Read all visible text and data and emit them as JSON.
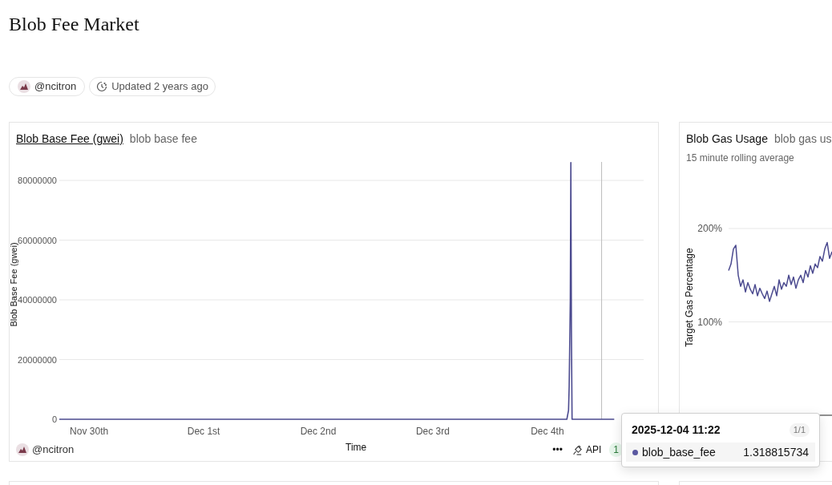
{
  "page": {
    "title": "Blob Fee Market"
  },
  "meta": {
    "author": "@ncitron",
    "updated": "Updated 2 years ago"
  },
  "fee_card": {
    "title": "Blob Base Fee (gwei)",
    "subtitle": "blob base fee",
    "chart_data": {
      "type": "line",
      "xlabel": "Time",
      "ylabel": "Blob Base Fee (gwei)",
      "x": [
        "2025-11-29T17:46",
        "2025-12-04T04:05",
        "2025-12-04T04:26",
        "2025-12-04T04:34",
        "2025-12-04T04:48",
        "2025-12-04T04:55",
        "2025-12-04T05:02",
        "2025-12-04T05:10",
        "2025-12-04T05:17",
        "2025-12-04T14:00"
      ],
      "series": [
        {
          "color": "#4b4a8f",
          "values": [
            0,
            0,
            3000000,
            11000000,
            40000000,
            86000000,
            30000000,
            0,
            0,
            0
          ]
        }
      ],
      "xlim": [
        "2025-11-29T17:46",
        "2025-12-04T20:10"
      ],
      "ylim": [
        0,
        86200000
      ],
      "grid": true,
      "ref_lines": [
        {
          "axis": "x",
          "value": "2025-12-04T11:22"
        }
      ],
      "xticks": [
        {
          "value": "2025-11-30T00:00",
          "label": "Nov 30th"
        },
        {
          "value": "2025-12-01T00:00",
          "label": "Dec 1st"
        },
        {
          "value": "2025-12-02T00:00",
          "label": "Dec 2nd"
        },
        {
          "value": "2025-12-03T00:00",
          "label": "Dec 3rd"
        },
        {
          "value": "2025-12-04T00:00",
          "label": "Dec 4th"
        }
      ],
      "yticks": [
        {
          "value": 0,
          "label": "0"
        },
        {
          "value": 20000000,
          "label": "20000000"
        },
        {
          "value": 40000000,
          "label": "40000000"
        },
        {
          "value": 60000000,
          "label": "60000000"
        },
        {
          "value": 80000000,
          "label": "80000000"
        }
      ]
    },
    "author": "@ncitron",
    "more": "•••",
    "api": "API",
    "badge": "1"
  },
  "gas_card": {
    "title": "Blob Gas Usage",
    "subtitle": "blob gas us",
    "note": "15 minute rolling average",
    "chart_data": {
      "type": "line",
      "ylabel": "Target Gas Percentage",
      "ylim": [
        0,
        2
      ],
      "yticks": [
        {
          "value": 1,
          "label": "100%"
        },
        {
          "value": 2,
          "label": "200%"
        }
      ],
      "series": [
        {
          "color": "#4b4a8f",
          "values": [
            1.55,
            1.62,
            1.78,
            1.82,
            1.5,
            1.38,
            1.45,
            1.32,
            1.42,
            1.35,
            1.3,
            1.4,
            1.28,
            1.36,
            1.3,
            1.25,
            1.33,
            1.22,
            1.3,
            1.38,
            1.28,
            1.45,
            1.35,
            1.42,
            1.38,
            1.5,
            1.4,
            1.48,
            1.36,
            1.45,
            1.5,
            1.42,
            1.55,
            1.48,
            1.6,
            1.52,
            1.62,
            1.58,
            1.7,
            1.65,
            1.78,
            1.85,
            1.68,
            1.75
          ]
        }
      ]
    }
  },
  "tooltip": {
    "time": "2025-12-04 11:22",
    "count": "1/1",
    "rows": [
      {
        "name": "blob_base_fee",
        "value": "1.318815734",
        "color": "#5a58a0"
      }
    ]
  }
}
